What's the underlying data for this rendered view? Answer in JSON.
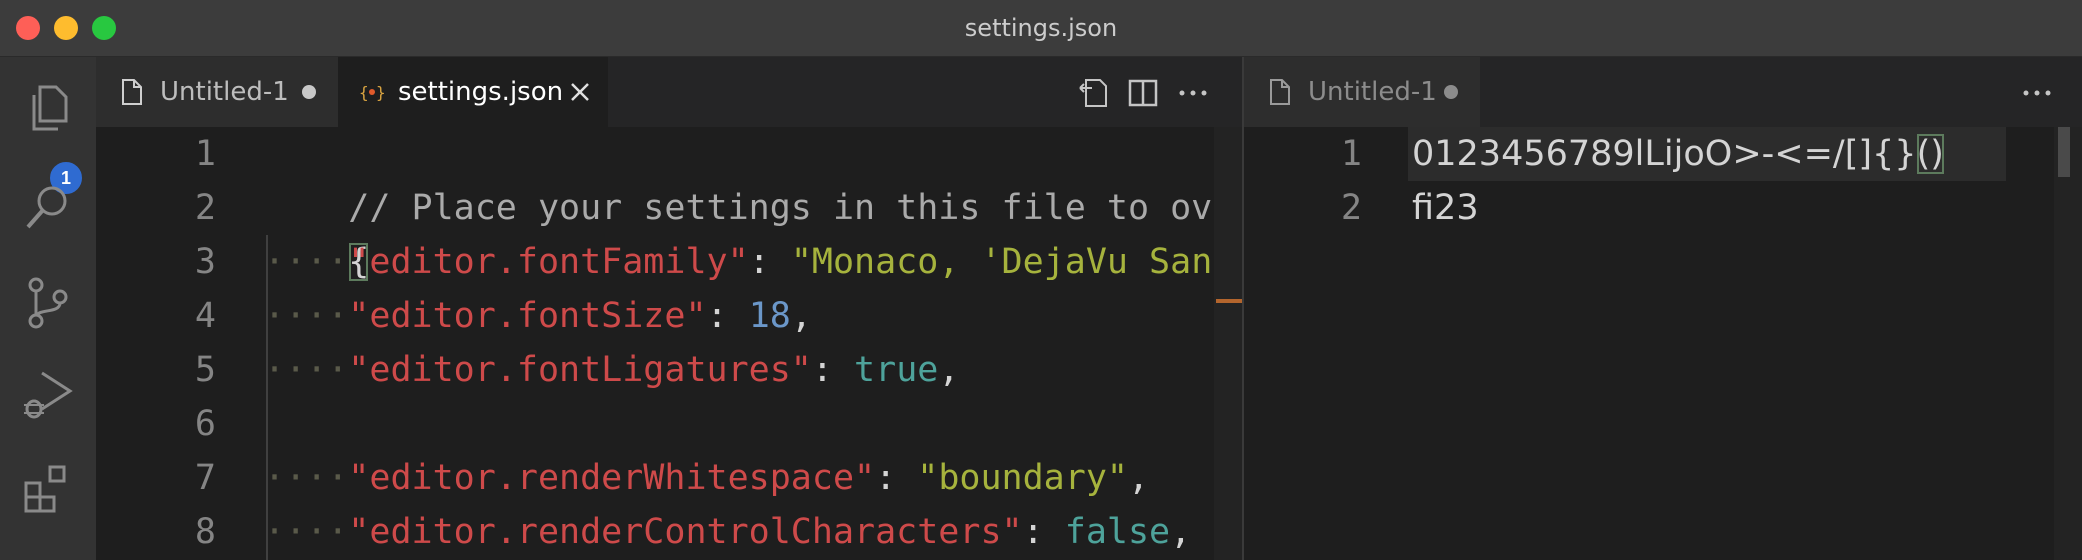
{
  "window": {
    "title": "settings.json"
  },
  "activity_bar": {
    "items": [
      {
        "name": "explorer",
        "icon": "files-icon",
        "badge": "1"
      },
      {
        "name": "search",
        "icon": "search-icon"
      },
      {
        "name": "source-control",
        "icon": "source-control-icon"
      },
      {
        "name": "run-and-debug",
        "icon": "run-debug-icon"
      },
      {
        "name": "extensions",
        "icon": "extensions-icon"
      }
    ]
  },
  "left_group": {
    "tabs": [
      {
        "label": "Untitled-1",
        "icon": "file-icon",
        "dirty": true,
        "active": false
      },
      {
        "label": "settings.json",
        "icon": "json-icon",
        "dirty": false,
        "active": true
      }
    ],
    "actions": [
      "open-changes-icon",
      "split-editor-icon",
      "more-actions-icon"
    ],
    "line_numbers": [
      "1",
      "2",
      "3",
      "4",
      "5",
      "6",
      "7",
      "8"
    ],
    "lines": {
      "l1": {
        "comment": "// Place your settings in this file to overwrite"
      },
      "l2": {
        "brace": "{"
      },
      "l3": {
        "ws": "····",
        "key": "\"editor.fontFamily\"",
        "colon": ": ",
        "value": "\"Monaco, 'DejaVu Sans Mono'\""
      },
      "l4": {
        "ws": "····",
        "key": "\"editor.fontSize\"",
        "colon": ": ",
        "value": "18",
        "comma": ","
      },
      "l5": {
        "ws": "····",
        "key": "\"editor.fontLigatures\"",
        "colon": ": ",
        "value": "true",
        "comma": ","
      },
      "l6": {},
      "l7": {
        "ws": "····",
        "key": "\"editor.renderWhitespace\"",
        "colon": ": ",
        "value": "\"boundary\"",
        "comma": ","
      },
      "l8": {
        "ws": "····",
        "key": "\"editor.renderControlCharacters\"",
        "colon": ": ",
        "value": "false",
        "comma": ","
      }
    }
  },
  "right_group": {
    "tabs": [
      {
        "label": "Untitled-1",
        "icon": "file-icon",
        "dirty": true,
        "active": true
      }
    ],
    "actions": [
      "more-actions-icon"
    ],
    "line_numbers": [
      "1",
      "2"
    ],
    "lines": {
      "l1": {
        "text": "0123456789lLijoO>-<=/[]{}",
        "paren": "()"
      },
      "l2": {
        "text": "fi23"
      }
    }
  },
  "colors": {
    "key": "#ce4a4a",
    "string": "#a6b33d",
    "number": "#6b97c9",
    "boolean": "#4ea39b",
    "comment": "#aaaaaa",
    "whitespace": "#5a5a4a",
    "badge": "#2f6bd1",
    "ruler_mark": "#b3652d"
  }
}
